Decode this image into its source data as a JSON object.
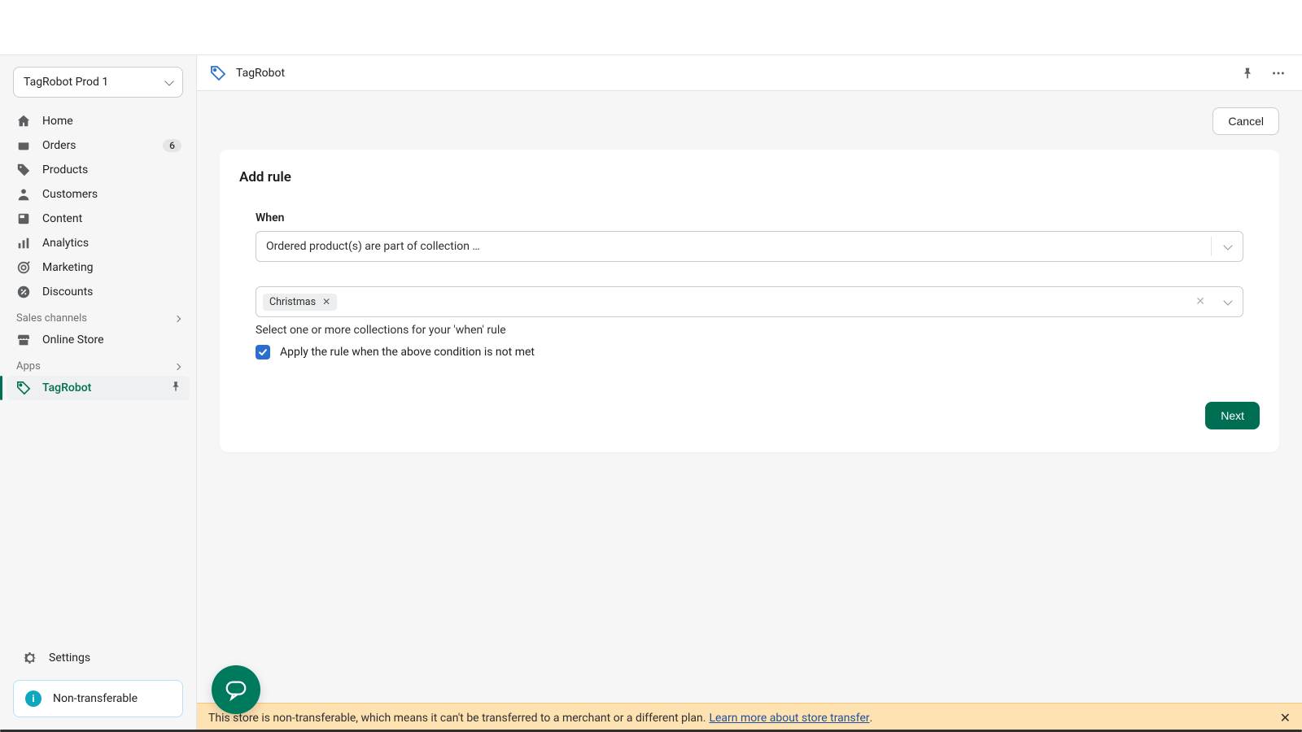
{
  "store_switcher": {
    "label": "TagRobot Prod 1"
  },
  "sidebar": {
    "items": [
      {
        "label": "Home"
      },
      {
        "label": "Orders",
        "badge": "6"
      },
      {
        "label": "Products"
      },
      {
        "label": "Customers"
      },
      {
        "label": "Content"
      },
      {
        "label": "Analytics"
      },
      {
        "label": "Marketing"
      },
      {
        "label": "Discounts"
      }
    ],
    "sales_channels_heading": "Sales channels",
    "online_store_label": "Online Store",
    "apps_heading": "Apps",
    "active_app_label": "TagRobot",
    "settings_label": "Settings",
    "non_transferable_label": "Non-transferable"
  },
  "header": {
    "app_title": "TagRobot"
  },
  "actions": {
    "cancel": "Cancel",
    "next": "Next"
  },
  "card": {
    "title": "Add rule",
    "when_label": "When",
    "when_value": "Ordered product(s) are part of collection …",
    "tags": [
      {
        "label": "Christmas"
      }
    ],
    "helper": "Select one or more collections for your 'when' rule",
    "checkbox_label": "Apply the rule when the above condition is not met",
    "checkbox_checked": true
  },
  "banner": {
    "text": "This store is non-transferable, which means it can't be transferred to a merchant or a different plan. ",
    "link_text": "Learn more about store transfer",
    "tail": "."
  }
}
